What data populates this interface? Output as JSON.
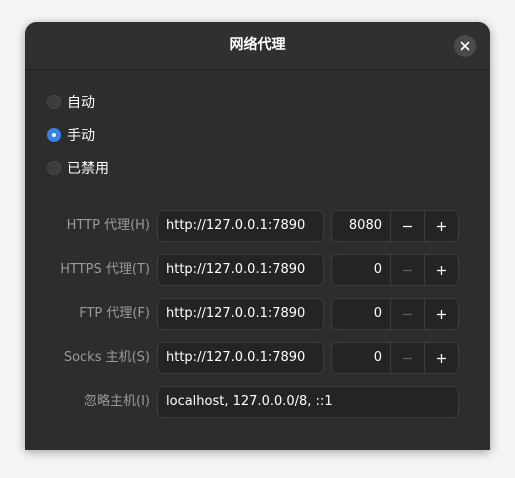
{
  "dialog": {
    "title": "网络代理"
  },
  "icons": {
    "close": "close-icon",
    "minus": "minus-icon",
    "plus": "plus-icon"
  },
  "colors": {
    "accent": "#3584e4",
    "background": "#2d2d2d",
    "field_background": "#242424"
  },
  "modes": [
    {
      "label": "自动",
      "checked": false
    },
    {
      "label": "手动",
      "checked": true
    },
    {
      "label": "已禁用",
      "checked": false
    }
  ],
  "proxies": [
    {
      "label": "HTTP 代理(H)",
      "url": "http://127.0.0.1:7890",
      "port": "8080",
      "minus_enabled": true
    },
    {
      "label": "HTTPS 代理(T)",
      "url": "http://127.0.0.1:7890",
      "port": "0",
      "minus_enabled": false
    },
    {
      "label": "FTP 代理(F)",
      "url": "http://127.0.0.1:7890",
      "port": "0",
      "minus_enabled": false
    },
    {
      "label": "Socks 主机(S)",
      "url": "http://127.0.0.1:7890",
      "port": "0",
      "minus_enabled": false
    }
  ],
  "ignore_hosts": {
    "label": "忽略主机(I)",
    "value": "localhost, 127.0.0.0/8, ::1"
  }
}
